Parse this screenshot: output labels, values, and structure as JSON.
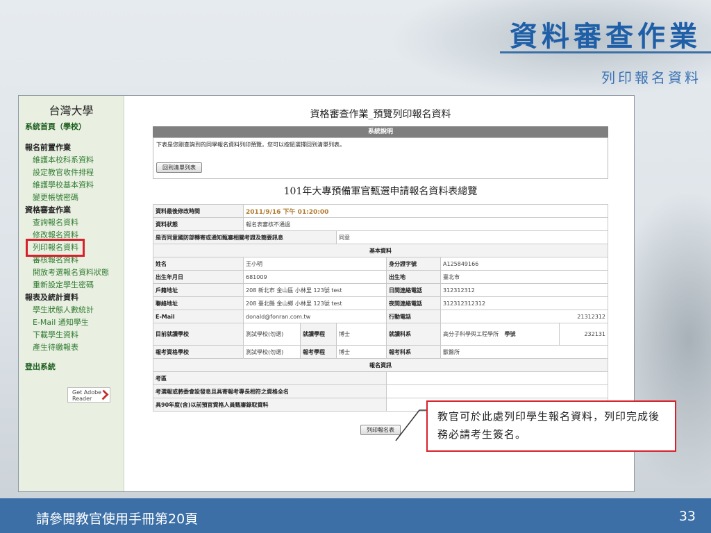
{
  "slide": {
    "title": "資料審查作業",
    "subtitle": "列印報名資料",
    "footer_note": "請參閱教官使用手冊第20頁",
    "page_number": "33",
    "callout": "教官可於此處列印學生報名資料，列印完成後務必請考生簽名。"
  },
  "sidebar": {
    "school": "台灣大學",
    "home": "系統首頁（學校）",
    "sections": [
      {
        "label": "報名前置作業",
        "items": [
          "維護本校科系資料",
          "設定教官收件排程",
          "維護學校基本資料",
          "變更帳號密碼"
        ]
      },
      {
        "label": "資格審查作業",
        "items": [
          "查詢報名資料",
          "修改報名資料",
          "列印報名資料",
          "審核報名資料",
          "開放考選報名資料狀態",
          "重新設定學生密碼"
        ]
      },
      {
        "label": "報表及統計資料",
        "items": [
          "學生狀態人數統計",
          "E-Mail 通知學生",
          "下載學生資料",
          "產生待繳報表"
        ]
      }
    ],
    "logout": "登出系統",
    "adobe_label": "Get Adobe Reader"
  },
  "page": {
    "heading": "資格審查作業_預覽列印報名資料",
    "system_bar": "系統說明",
    "note": "下表是您剛查詢到的同學報名資料列印預覽，您可以按鈕選擇回到清單列表。",
    "back_button": "回到清單列表",
    "table_title": "101年大專預備軍官甄選申請報名資料表總覽",
    "print_button": "列印報名表"
  },
  "record": {
    "last_modified_label": "資料最後修改時間",
    "last_modified": "2011/9/16 下午 01:20:00",
    "status_label": "資料狀態",
    "status": "報名表審核不通過",
    "consent_label": "是否同意國防部轉寄或通知甄審相關考證及簡要訊息",
    "consent": "同意",
    "basic_section": "基本資料",
    "name_label": "姓名",
    "name": "王小明",
    "id_label": "身分證字號",
    "id": "A125849166",
    "birth_label": "出生年月日",
    "birth": "681009",
    "birthplace_label": "出生地",
    "birthplace": "臺北市",
    "reg_addr_label": "戶籍地址",
    "reg_addr": "208 新北市 金山區 小林里 123號 test",
    "day_phone_label": "日間連絡電話",
    "day_phone": "312312312",
    "contact_addr_label": "聯絡地址",
    "contact_addr": "208 臺北縣 金山鄉 小林里 123號 test",
    "night_phone_label": "夜間連絡電話",
    "night_phone": "312312312312",
    "email_label": "E-Mail",
    "email": "donald@fonran.com.tw",
    "mobile_label": "行動電話",
    "mobile": "21312312",
    "cur_school_label": "目前就讀學校",
    "cur_school": "測試學校(勿選)",
    "cur_level_label": "就讀學程",
    "cur_level": "博士",
    "cur_dept_label": "就讀科系",
    "cur_dept": "高分子科學與工程學所",
    "grade_label": "學號",
    "grade": "232131",
    "exam_school_label": "報考資格學校",
    "exam_school": "測試學校(勿選)",
    "exam_level_label": "報考學程",
    "exam_level": "博士",
    "exam_dept_label": "報考科系",
    "exam_dept": "獸醫所",
    "signup_section": "報名資訊",
    "exam_label": "考區",
    "committee_label": "考選報或將委會設發息且具寄報考專長相符之資格全名",
    "military_label": "具90年度(含)以前預官資格人員甄審錄取資料"
  }
}
